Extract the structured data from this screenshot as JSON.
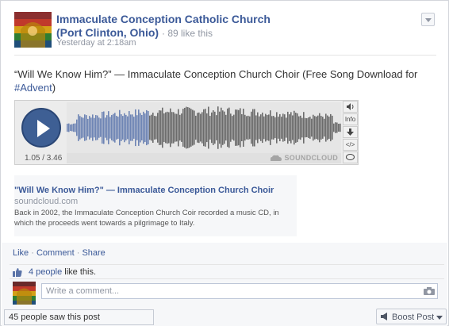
{
  "post": {
    "page_name": "Immaculate Conception Catholic Church (Port Clinton, Ohio)",
    "like_count": "· 89 like this",
    "timestamp": "Yesterday at 2:18am",
    "message_text": "“Will We Know Him?” — Immaculate Conception Church Choir (Free Song Download for",
    "hashtag": "#Advent",
    "hashtag_suffix": ")"
  },
  "player": {
    "time": "1.05 / 3.46",
    "progress_fraction": 0.3,
    "brand": "SOUNDCLOUD",
    "controls": [
      "volume",
      "info",
      "download",
      "embed",
      "comment"
    ],
    "info_label": "Info",
    "embed_label": "</>",
    "colors": {
      "played": "#6d84b4",
      "unplayed": "#6b6b6b",
      "button": "#3e5f94"
    }
  },
  "link_preview": {
    "title": "\"Will We Know Him?\" — Immaculate Conception Church Choir",
    "domain": "soundcloud.com",
    "description": "Back in 2002, the Immaculate Conception Church Coir recorded a music CD, in which the proceeds went towards a pilgrimage to Italy."
  },
  "actions": {
    "like": "Like",
    "sep1": " · ",
    "comment": "Comment",
    "sep2": " · ",
    "share": "Share"
  },
  "likes": {
    "people": "4 people",
    "suffix": " like this."
  },
  "comment": {
    "placeholder": "Write a comment..."
  },
  "footer": {
    "seen": "45 people saw this post",
    "boost": "Boost Post"
  },
  "colors": {
    "link_blue": "#3b5998",
    "meta_gray": "#9197a3",
    "panel_bg": "#f6f7f9"
  }
}
